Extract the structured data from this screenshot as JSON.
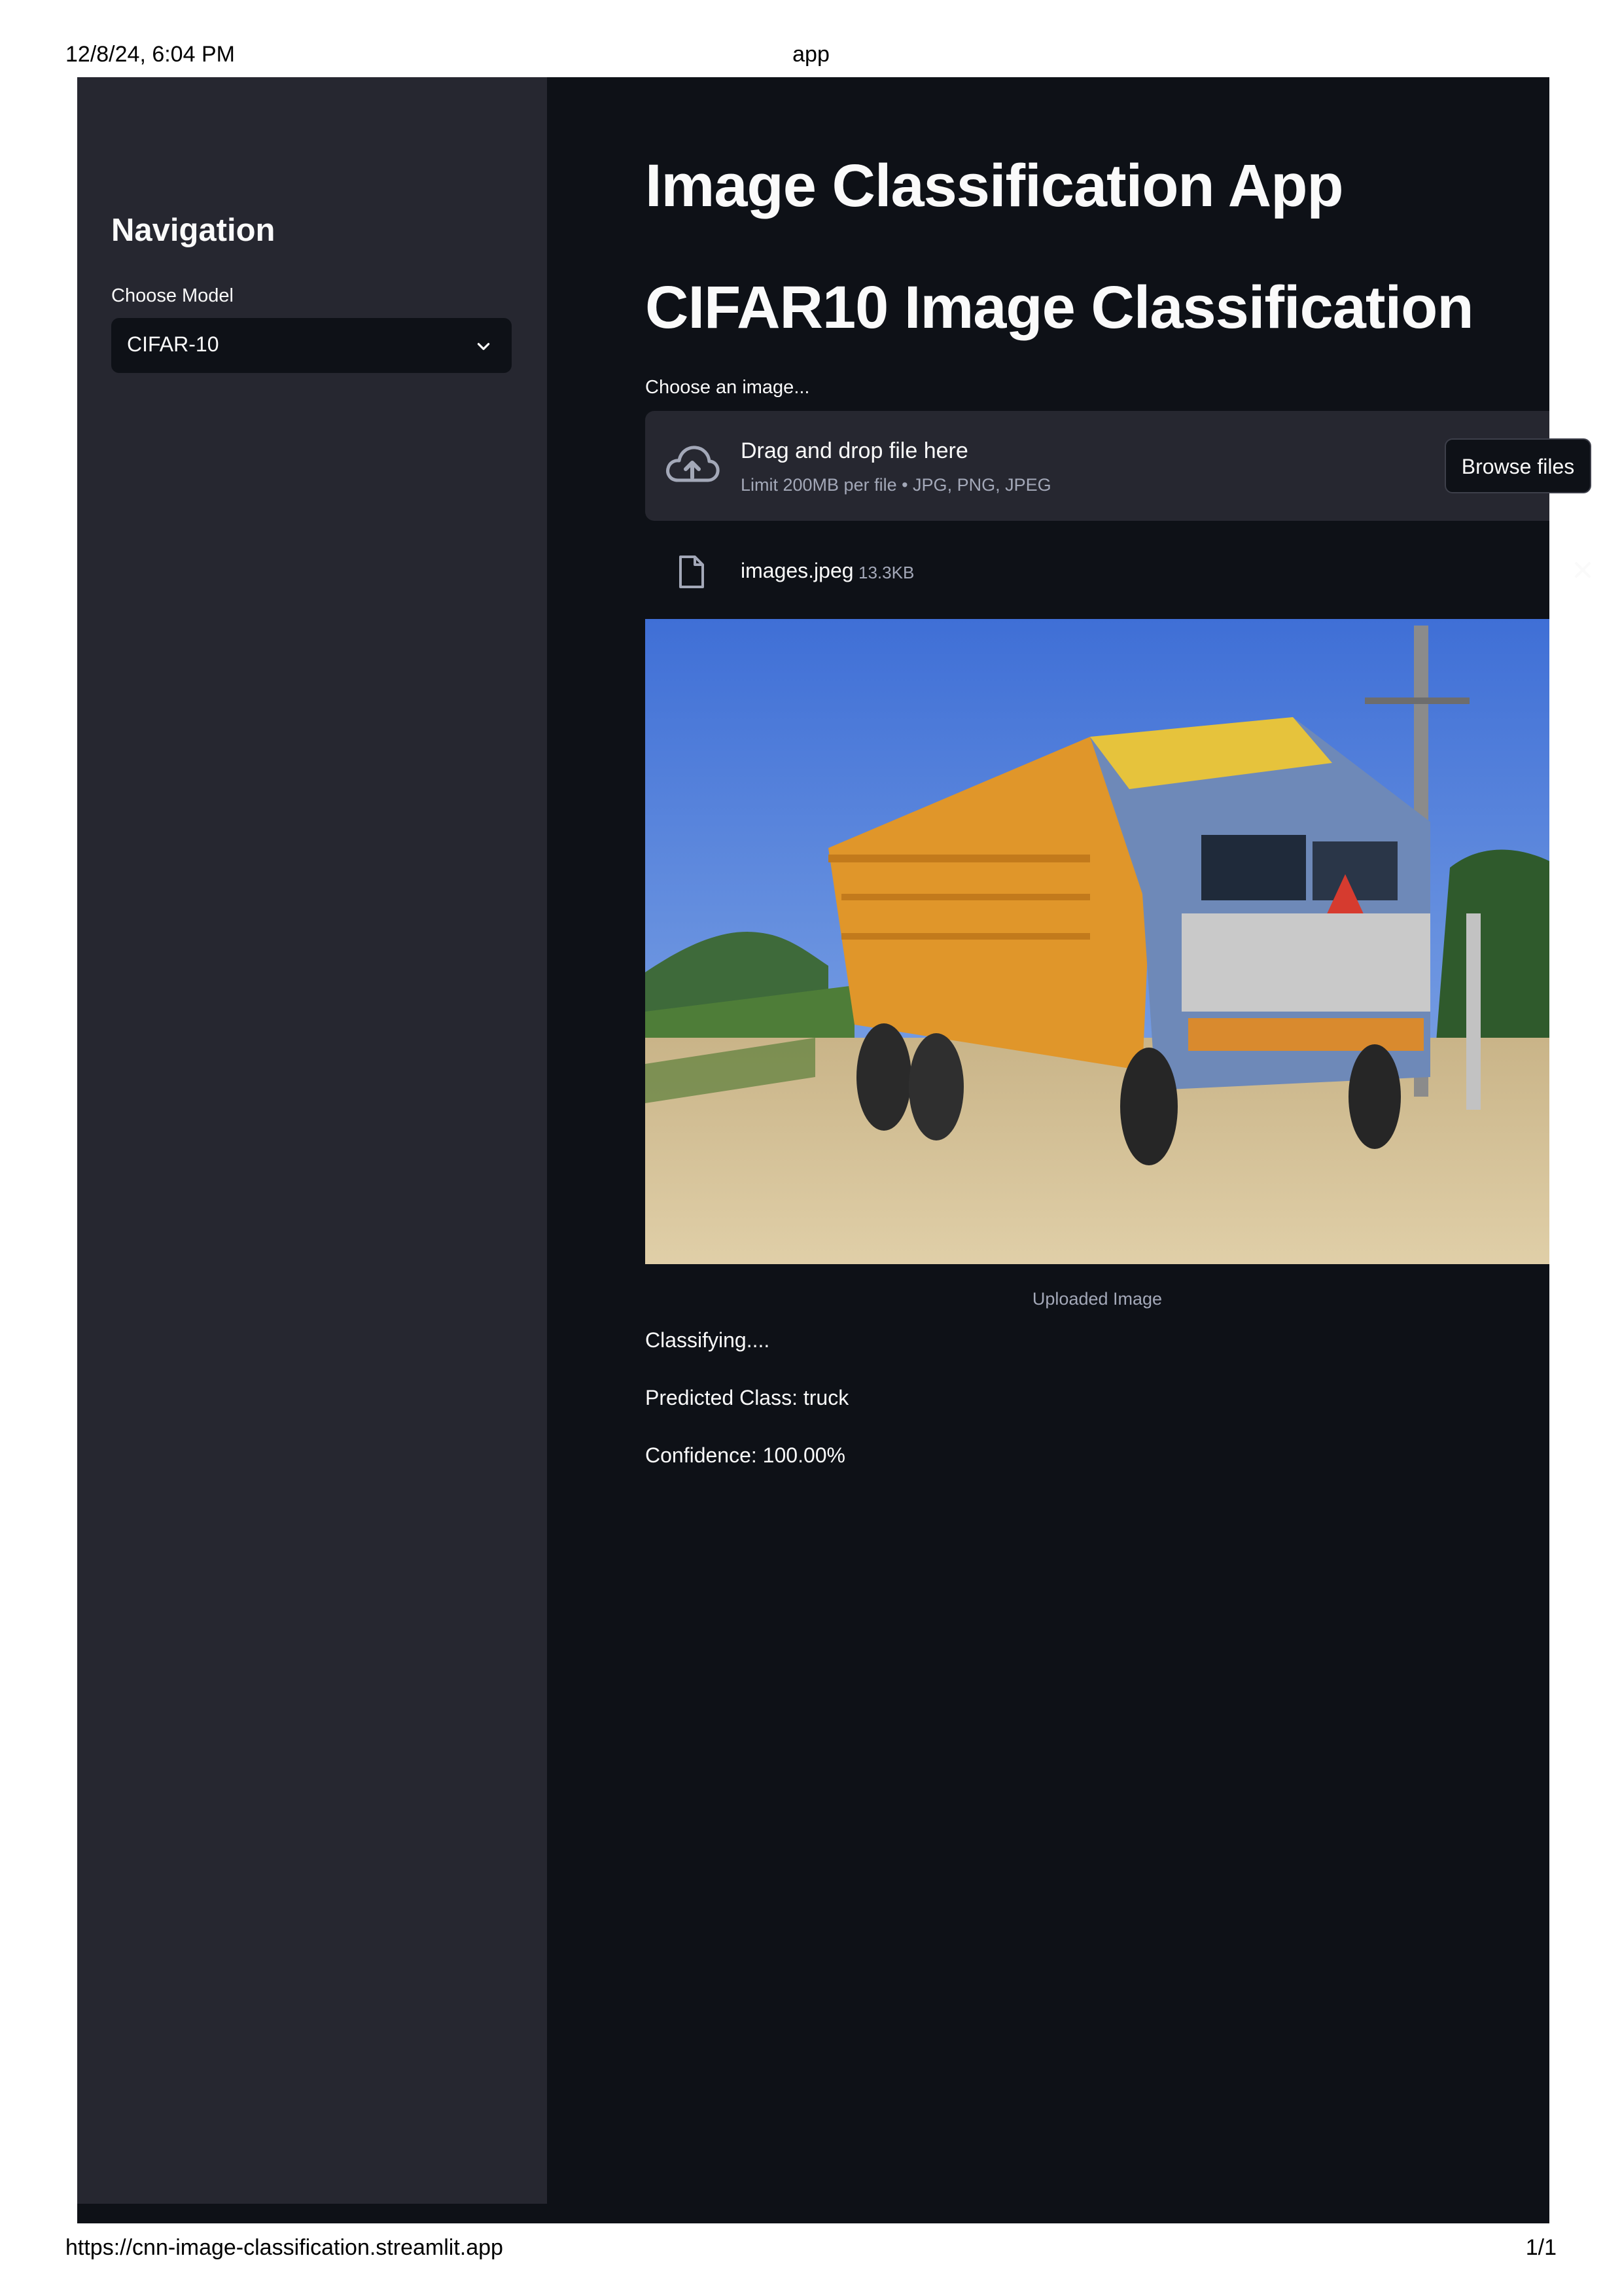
{
  "print": {
    "datetime": "12/8/24, 6:04 PM",
    "page_title": "app",
    "url": "https://cnn-image-classification.streamlit.app",
    "page_number": "1/1"
  },
  "sidebar": {
    "title": "Navigation",
    "model_label": "Choose Model",
    "model_selected": "CIFAR-10"
  },
  "main": {
    "title": "Image Classification App",
    "subtitle": "CIFAR10 Image Classification",
    "uploader": {
      "label": "Choose an image...",
      "drop_title": "Drag and drop file here",
      "drop_limit": "Limit 200MB per file • JPG, PNG, JPEG",
      "browse_label": "Browse files"
    },
    "file": {
      "name": "images.jpeg",
      "size": "13.3KB"
    },
    "image_caption": "Uploaded Image",
    "status": "Classifying....",
    "prediction": "Predicted Class: truck",
    "confidence": "Confidence: 100.00%"
  },
  "colors": {
    "app_background": "#0e1117",
    "sidebar_background": "#262730",
    "text": "#fafafa",
    "muted_text": "#a3a8b8"
  },
  "icons": [
    "cloud-upload-icon",
    "chevron-down-icon",
    "file-icon",
    "close-icon"
  ]
}
